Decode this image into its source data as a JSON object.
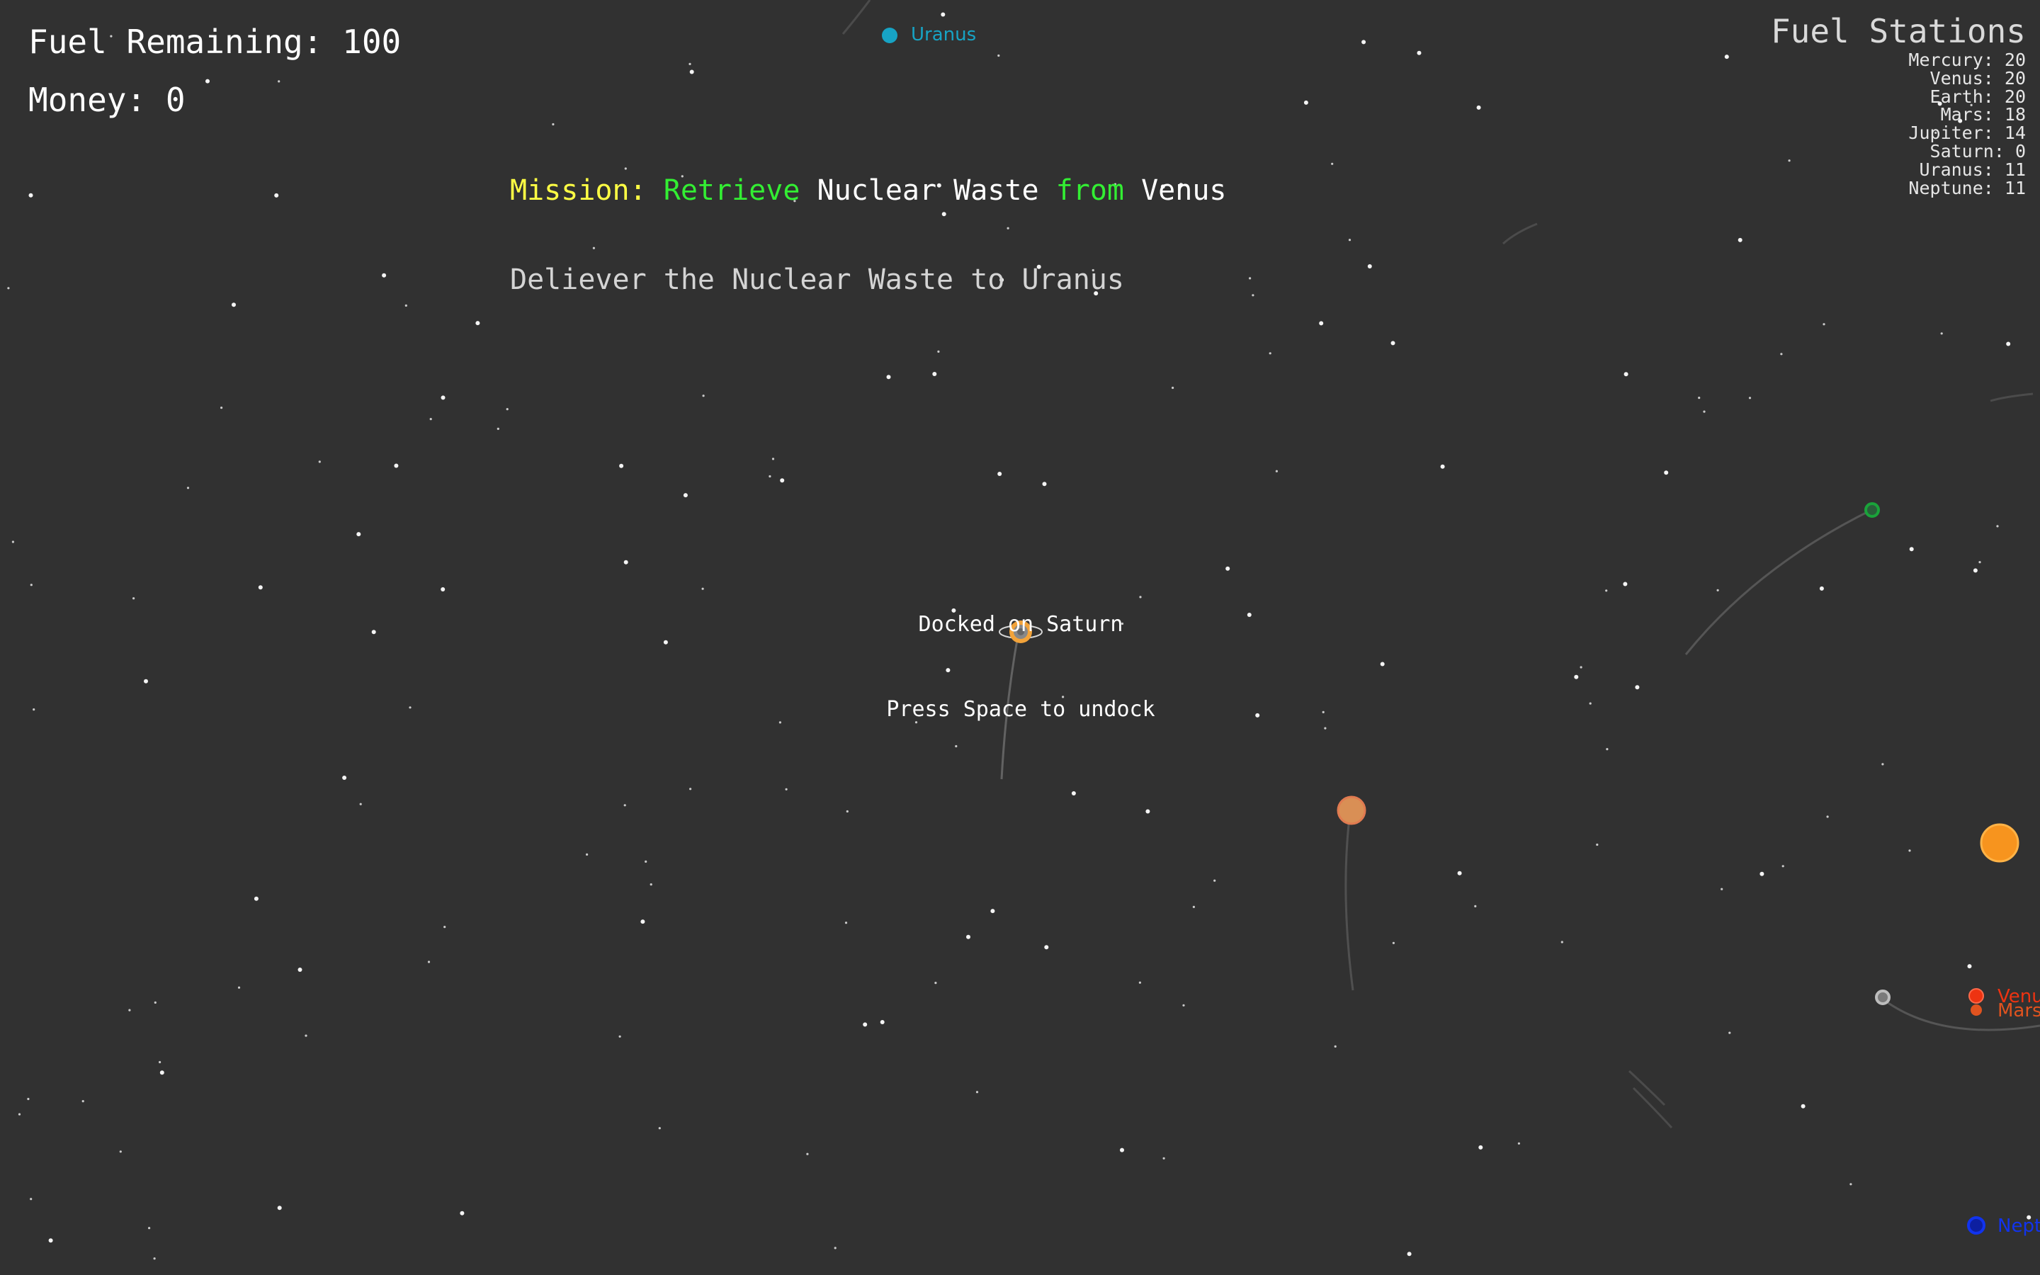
{
  "hud": {
    "fuel_label": "Fuel Remaining:",
    "fuel_value": "100",
    "money_label": "Money:",
    "money_value": "0"
  },
  "mission": {
    "prefix": "Mission:",
    "verb": "Retrieve",
    "cargo": "Nuclear Waste",
    "preposition": "from",
    "origin": "Venus",
    "line2": "Deliever the Nuclear Waste to Uranus"
  },
  "status": {
    "line1": "Docked on Saturn",
    "line2": "Press Space to undock"
  },
  "fuel_stations": {
    "title": "Fuel Stations",
    "stations": [
      {
        "name": "Mercury",
        "fuel": "20"
      },
      {
        "name": "Venus",
        "fuel": "20"
      },
      {
        "name": "Earth",
        "fuel": "20"
      },
      {
        "name": "Mars",
        "fuel": "18"
      },
      {
        "name": "Jupiter",
        "fuel": "14"
      },
      {
        "name": "Saturn",
        "fuel": "0"
      },
      {
        "name": "Uranus",
        "fuel": "11"
      },
      {
        "name": "Neptune",
        "fuel": "11"
      }
    ]
  },
  "planet_labels": {
    "uranus": "Uranus",
    "venus": "Venu",
    "mars": "Mars",
    "neptune": "Nept"
  },
  "colors": {
    "background": "#313131",
    "mission_prefix": "#ffff44",
    "mission_highlight": "#33ee33",
    "uranus": "#17a3c4",
    "venus": "#ee3311",
    "mars": "#e0531f",
    "neptune": "#1133ee",
    "earth": "#1aa33a",
    "sun": "#f7941e",
    "jupiter": "#d98f55",
    "saturn": "#f2a33a"
  }
}
